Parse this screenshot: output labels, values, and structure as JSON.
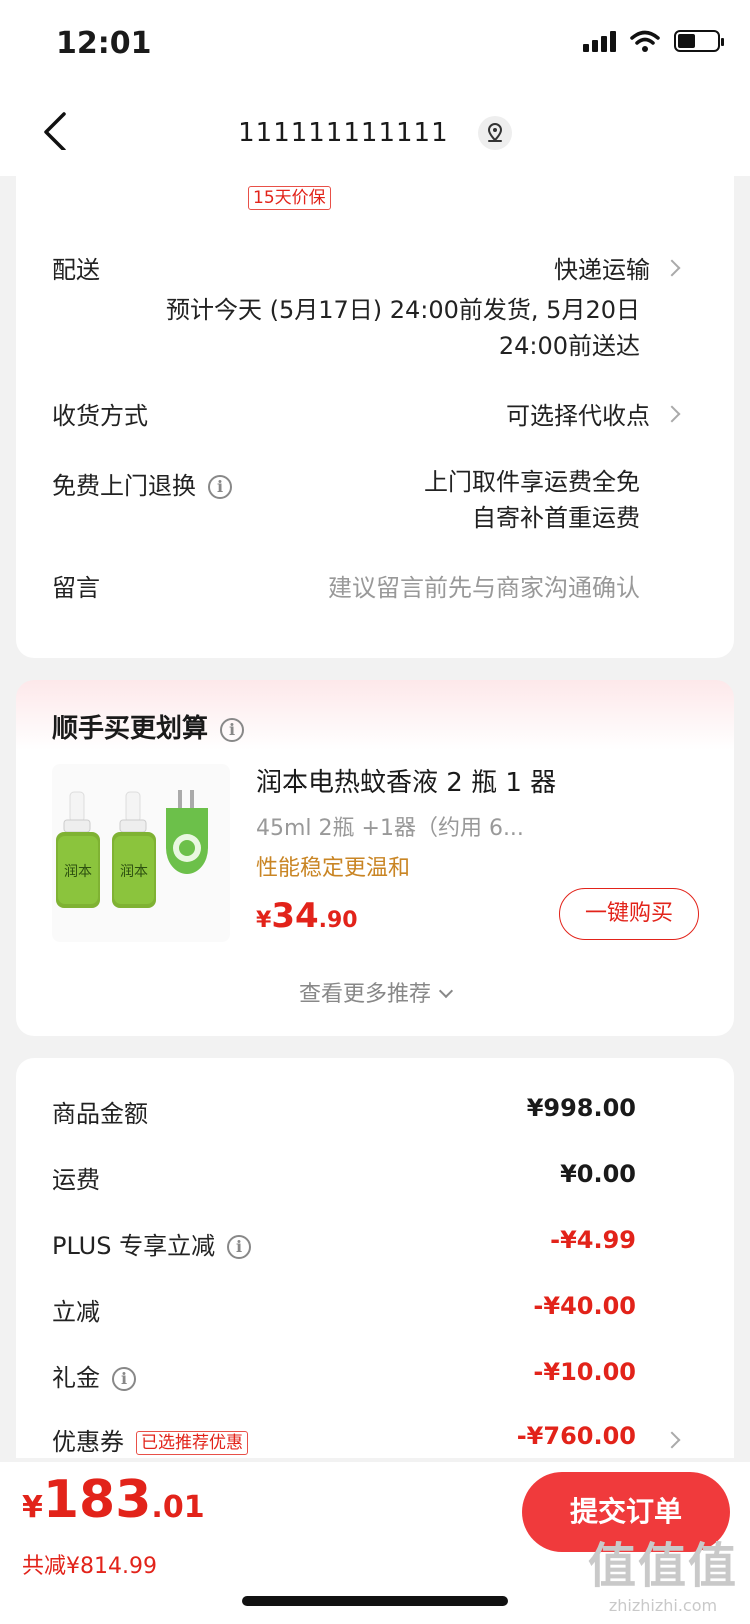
{
  "status_bar": {
    "time": "12:01"
  },
  "nav": {
    "title": "111111111111"
  },
  "delivery_card": {
    "tag": "15天价保",
    "delivery": {
      "label": "配送",
      "method": "快递运输",
      "line1": "预计今天 (5月17日) 24:00前发货, 5月20日",
      "line2": "24:00前送达"
    },
    "receive": {
      "label": "收货方式",
      "value": "可选择代收点"
    },
    "free_return": {
      "label": "免费上门退换",
      "line1": "上门取件享运费全免",
      "line2": "自寄补首重运费"
    },
    "message": {
      "label": "留言",
      "placeholder": "建议留言前先与商家沟通确认"
    }
  },
  "recommend_card": {
    "title": "顺手买更划算",
    "product": {
      "name": "润本电热蚊香液 2 瓶 1 器",
      "spec": "45ml 2瓶 +1器（约用 6...",
      "tagline": "性能稳定更温和",
      "price_currency": "¥",
      "price_int": "34",
      "price_dec": ".90",
      "image_brand": "润本",
      "buy_label": "一键购买"
    },
    "more_label": "查看更多推荐"
  },
  "price_card": {
    "rows": [
      {
        "label": "商品金额",
        "value": "¥998.00"
      },
      {
        "label": "运费",
        "value": "¥0.00"
      },
      {
        "label": "PLUS 专享立减",
        "value": "-¥4.99"
      },
      {
        "label": "立减",
        "value": "-¥40.00"
      },
      {
        "label": "礼金",
        "value": "-¥10.00"
      },
      {
        "label": "优惠券",
        "value": "-¥760.00"
      }
    ],
    "coupon_tag": "已选推荐优惠"
  },
  "bottom_bar": {
    "total_currency": "¥",
    "total_int": "183",
    "total_dec": ".01",
    "saved": "共减¥814.99",
    "submit_label": "提交订单"
  },
  "watermark": {
    "big": "值值值",
    "small": "zhizhizhi.com"
  },
  "colors": {
    "accent": "#e2231a",
    "submit_bg": "#f03a3c",
    "tag_gold": "#c98524"
  }
}
